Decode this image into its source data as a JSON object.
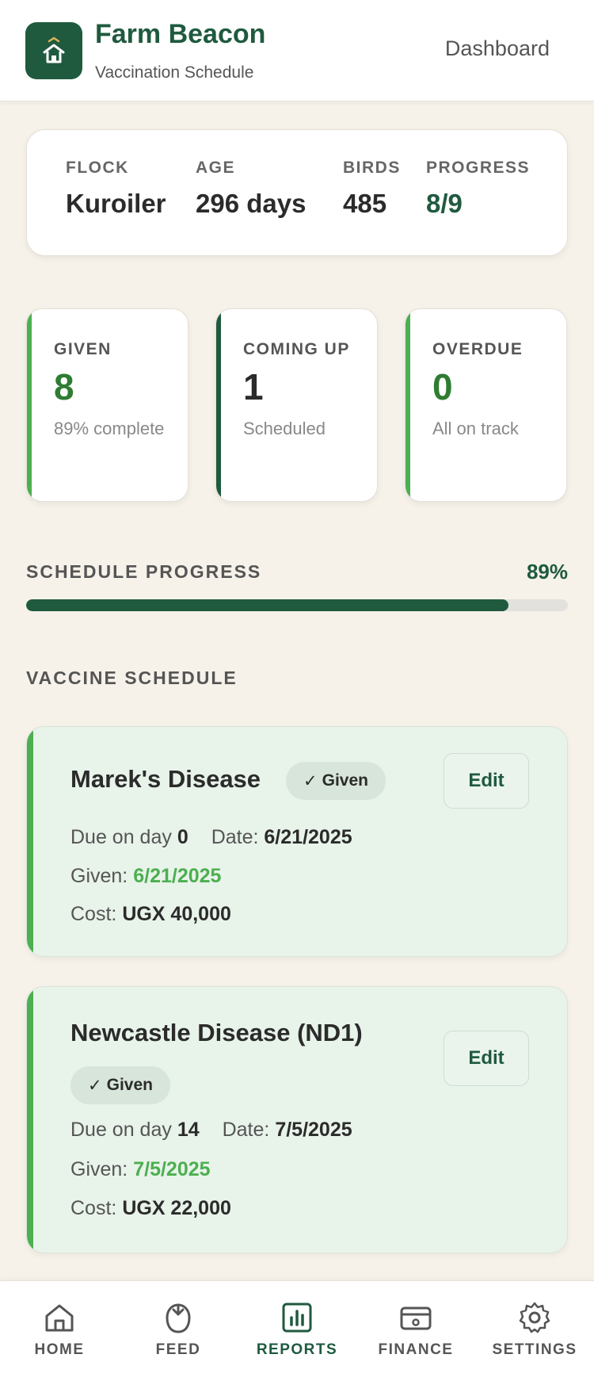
{
  "header": {
    "title": "Farm Beacon",
    "subtitle": "Vaccination Schedule",
    "dashboard_link": "Dashboard"
  },
  "flock": {
    "flock_label": "FLOCK",
    "flock_value": "Kuroiler",
    "age_label": "AGE",
    "age_value": "296 days",
    "birds_label": "BIRDS",
    "birds_value": "485",
    "progress_label": "PROGRESS",
    "progress_value": "8/9"
  },
  "stats": {
    "given": {
      "label": "GIVEN",
      "value": "8",
      "sub": "89% complete",
      "accent": "#4caf50",
      "value_color": "#2e7d32"
    },
    "coming_up": {
      "label": "COMING UP",
      "value": "1",
      "sub": "Scheduled",
      "accent": "#1f5a3f",
      "value_color": "#2b2b2b"
    },
    "overdue": {
      "label": "OVERDUE",
      "value": "0",
      "sub": "All on track",
      "accent": "#4caf50",
      "value_color": "#2e7d32"
    }
  },
  "schedule_progress": {
    "label": "SCHEDULE PROGRESS",
    "percent_text": "89%",
    "fraction": 0.89
  },
  "vaccine_schedule": {
    "label": "VACCINE SCHEDULE",
    "items": [
      {
        "name": "Marek's Disease",
        "badge": "Given",
        "badge_icon": "check-icon",
        "edit_label": "Edit",
        "due_prefix": "Due on day",
        "due_day": "0",
        "date_prefix": "Date:",
        "date": "6/21/2025",
        "given_prefix": "Given:",
        "given_date": "6/21/2025",
        "cost_prefix": "Cost:",
        "cost": "UGX 40,000"
      },
      {
        "name": "Newcastle Disease (ND1)",
        "badge": "Given",
        "badge_icon": "check-icon",
        "edit_label": "Edit",
        "due_prefix": "Due on day",
        "due_day": "14",
        "date_prefix": "Date:",
        "date": "7/5/2025",
        "given_prefix": "Given:",
        "given_date": "7/5/2025",
        "cost_prefix": "Cost:",
        "cost": "UGX 22,000"
      }
    ]
  },
  "nav": {
    "items": [
      {
        "label": "HOME",
        "icon": "home-icon"
      },
      {
        "label": "FEED",
        "icon": "feed-icon"
      },
      {
        "label": "REPORTS",
        "icon": "reports-icon",
        "active": true
      },
      {
        "label": "FINANCE",
        "icon": "finance-icon"
      },
      {
        "label": "SETTINGS",
        "icon": "gear-icon"
      }
    ]
  },
  "colors": {
    "brand": "#1f5a3f",
    "accent_green": "#4caf50",
    "background": "#f6f2ea",
    "card_given_bg": "#e8f3ea"
  }
}
